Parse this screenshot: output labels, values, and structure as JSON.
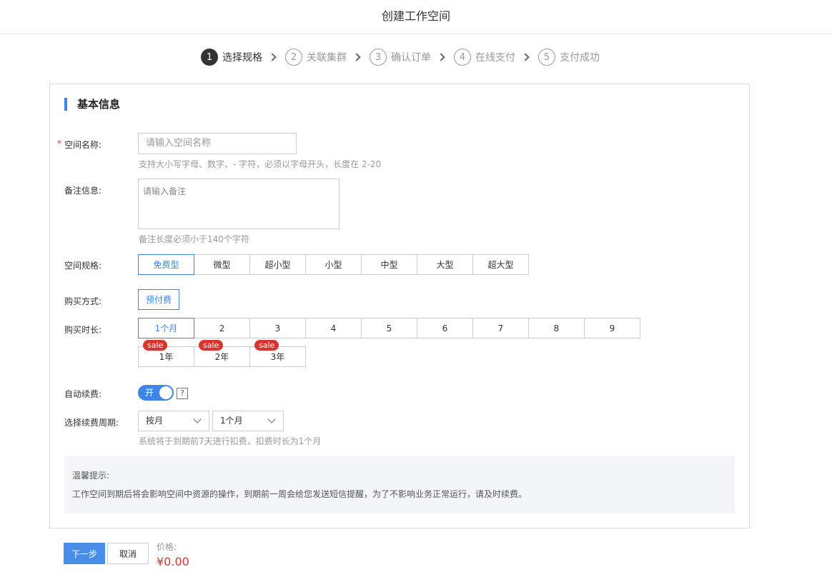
{
  "header": {
    "title": "创建工作空间"
  },
  "steps": [
    {
      "num": "1",
      "label": "选择规格",
      "active": true
    },
    {
      "num": "2",
      "label": "关联集群",
      "active": false
    },
    {
      "num": "3",
      "label": "确认订单",
      "active": false
    },
    {
      "num": "4",
      "label": "在线支付",
      "active": false
    },
    {
      "num": "5",
      "label": "支付成功",
      "active": false
    }
  ],
  "section": {
    "title": "基本信息"
  },
  "form": {
    "name": {
      "required_mark": "*",
      "label": "空间名称:",
      "placeholder": "请输入空间名称",
      "hint": "支持大小写字母、数字、- 字符，必须以字母开头，长度在 2-20"
    },
    "remark": {
      "label": "备注信息:",
      "placeholder": "请输入备注",
      "hint": "备注长度必须小于140个字符"
    },
    "spec": {
      "label": "空间规格:",
      "options": [
        "免费型",
        "微型",
        "超小型",
        "小型",
        "中型",
        "大型",
        "超大型"
      ],
      "selected": "免费型"
    },
    "purchase_method": {
      "label": "购买方式:",
      "option": "预付费"
    },
    "duration": {
      "label": "购买时长:",
      "months": [
        "1个月",
        "2",
        "3",
        "4",
        "5",
        "6",
        "7",
        "8",
        "9"
      ],
      "selected": "1个月",
      "years": [
        "1年",
        "2年",
        "3年"
      ],
      "sale_badge": "sale"
    },
    "auto_renew": {
      "label": "自动续费:",
      "toggle_text": "开",
      "enabled": true,
      "help_icon": "?"
    },
    "renew_cycle": {
      "label": "选择续费周期:",
      "unit_value": "按月",
      "period_value": "1个月",
      "hint": "系统将于到期前7天进行扣费，扣费时长为1个月"
    }
  },
  "notice": {
    "title": "温馨提示:",
    "body": "工作空间到期后将会影响空间中资源的操作，到期前一周会给您发送短信提醒，为了不影响业务正常运行，请及时续费。"
  },
  "footer": {
    "next_label": "下一步",
    "cancel_label": "取消",
    "price_label": "价格:",
    "price_value": "¥0.00"
  },
  "colors": {
    "accent": "#3d86e8",
    "price": "#d9352c",
    "sale": "#d9352c"
  }
}
